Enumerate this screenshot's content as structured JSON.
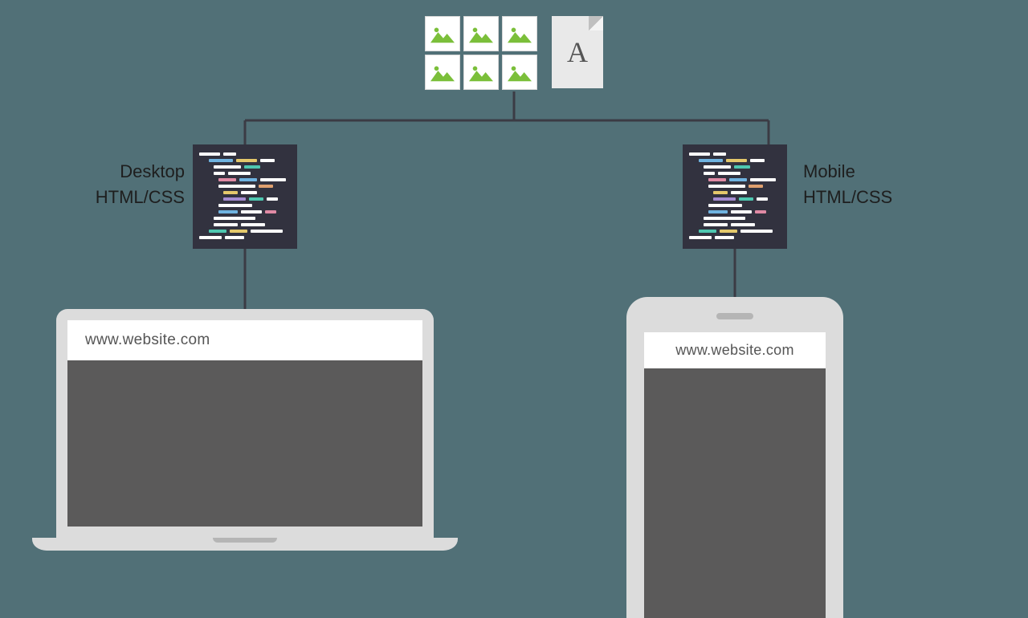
{
  "labels": {
    "desktop_l1": "Desktop",
    "desktop_l2": "HTML/CSS",
    "mobile_l1": "Mobile",
    "mobile_l2": "HTML/CSS"
  },
  "url": "www.website.com",
  "doc_glyph": "A",
  "code_colors": {
    "white": "#ffffff",
    "blue": "#6fb3e0",
    "teal": "#4ec7b0",
    "yellow": "#e4c86b",
    "pink": "#e08aa4",
    "purple": "#a48bd1",
    "orange": "#e0a06f"
  }
}
